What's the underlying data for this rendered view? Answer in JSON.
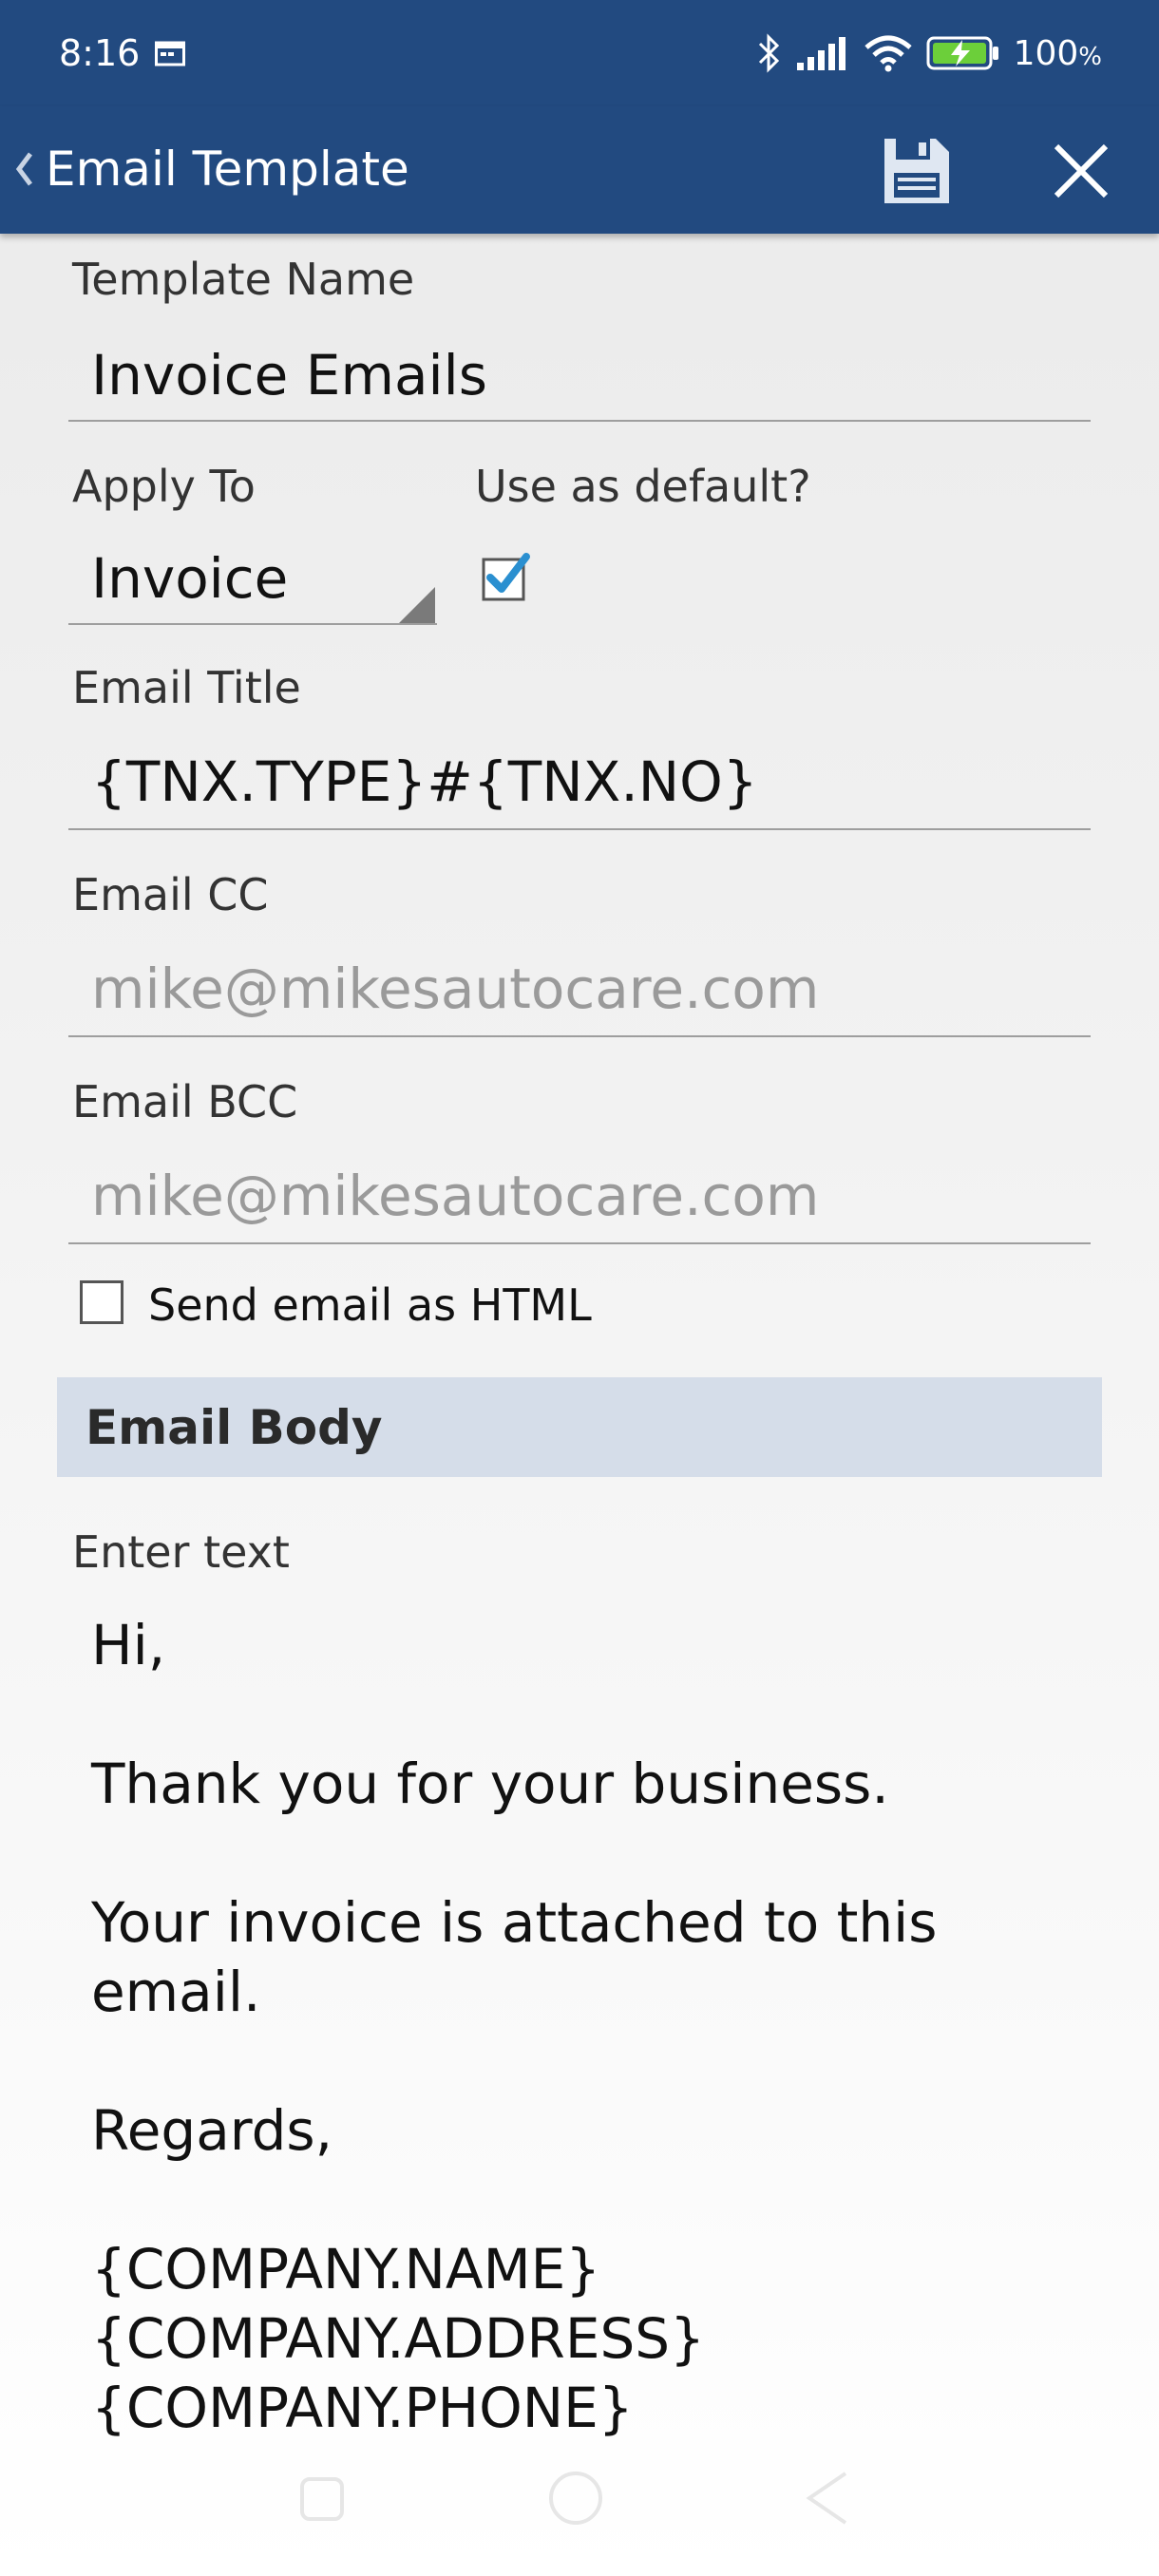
{
  "status_bar": {
    "time": "8:16",
    "battery_percent": "100",
    "battery_unit": "%",
    "icons": [
      "calendar-icon",
      "bluetooth-icon",
      "signal-icon",
      "wifi-icon",
      "battery-charging-icon"
    ]
  },
  "app_bar": {
    "title": "Email Template",
    "icons": [
      "back-chevron-icon",
      "save-icon",
      "close-icon"
    ]
  },
  "form": {
    "template_name_label": "Template Name",
    "template_name_value": "Invoice Emails",
    "apply_to_label": "Apply To",
    "apply_to_value": "Invoice",
    "use_default_label": "Use as default?",
    "use_default_checked": true,
    "email_title_label": "Email Title",
    "email_title_value": "{TNX.TYPE}#{TNX.NO}",
    "email_cc_label": "Email CC",
    "email_cc_placeholder": "mike@mikesautocare.com",
    "email_bcc_label": "Email BCC",
    "email_bcc_placeholder": "mike@mikesautocare.com",
    "send_html_label": "Send email as HTML",
    "send_html_checked": false
  },
  "email_body": {
    "section_title": "Email Body",
    "label": "Enter text",
    "lines": [
      "Hi,",
      "",
      "Thank you for your business.",
      "",
      "Your invoice is attached to this",
      "email.",
      "",
      "Regards,",
      "",
      "{COMPANY.NAME}",
      "{COMPANY.ADDRESS}",
      "{COMPANY.PHONE}"
    ]
  },
  "colors": {
    "app_bar": "#224a80",
    "section_header": "#d5dde9",
    "checkbox_accent": "#2a8fd0"
  }
}
